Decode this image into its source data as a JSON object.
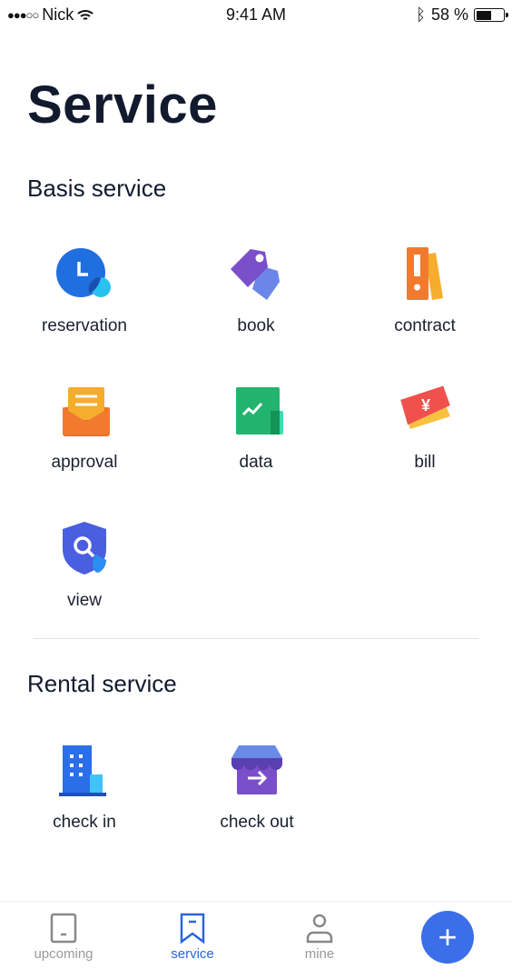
{
  "status_bar": {
    "carrier": "Nick",
    "time": "9:41 AM",
    "battery": "58 %",
    "battery_level": 0.58
  },
  "page_title": "Service",
  "sections": [
    {
      "title": "Basis service",
      "items": [
        {
          "label": "reservation",
          "icon": "clock-icon"
        },
        {
          "label": "book",
          "icon": "tag-icon"
        },
        {
          "label": "contract",
          "icon": "binder-icon"
        },
        {
          "label": "approval",
          "icon": "envelope-icon"
        },
        {
          "label": "data",
          "icon": "chart-icon"
        },
        {
          "label": "bill",
          "icon": "ticket-icon"
        },
        {
          "label": "view",
          "icon": "shield-search-icon"
        }
      ]
    },
    {
      "title": "Rental service",
      "items": [
        {
          "label": "check in",
          "icon": "building-icon"
        },
        {
          "label": "check out",
          "icon": "store-exit-icon"
        }
      ]
    }
  ],
  "tabbar": {
    "tabs": [
      {
        "label": "upcoming"
      },
      {
        "label": "service",
        "active": true
      },
      {
        "label": "mine"
      }
    ],
    "add_label": "+"
  },
  "colors": {
    "accent": "#3b6ee8",
    "active_tab": "#2a66d8"
  }
}
